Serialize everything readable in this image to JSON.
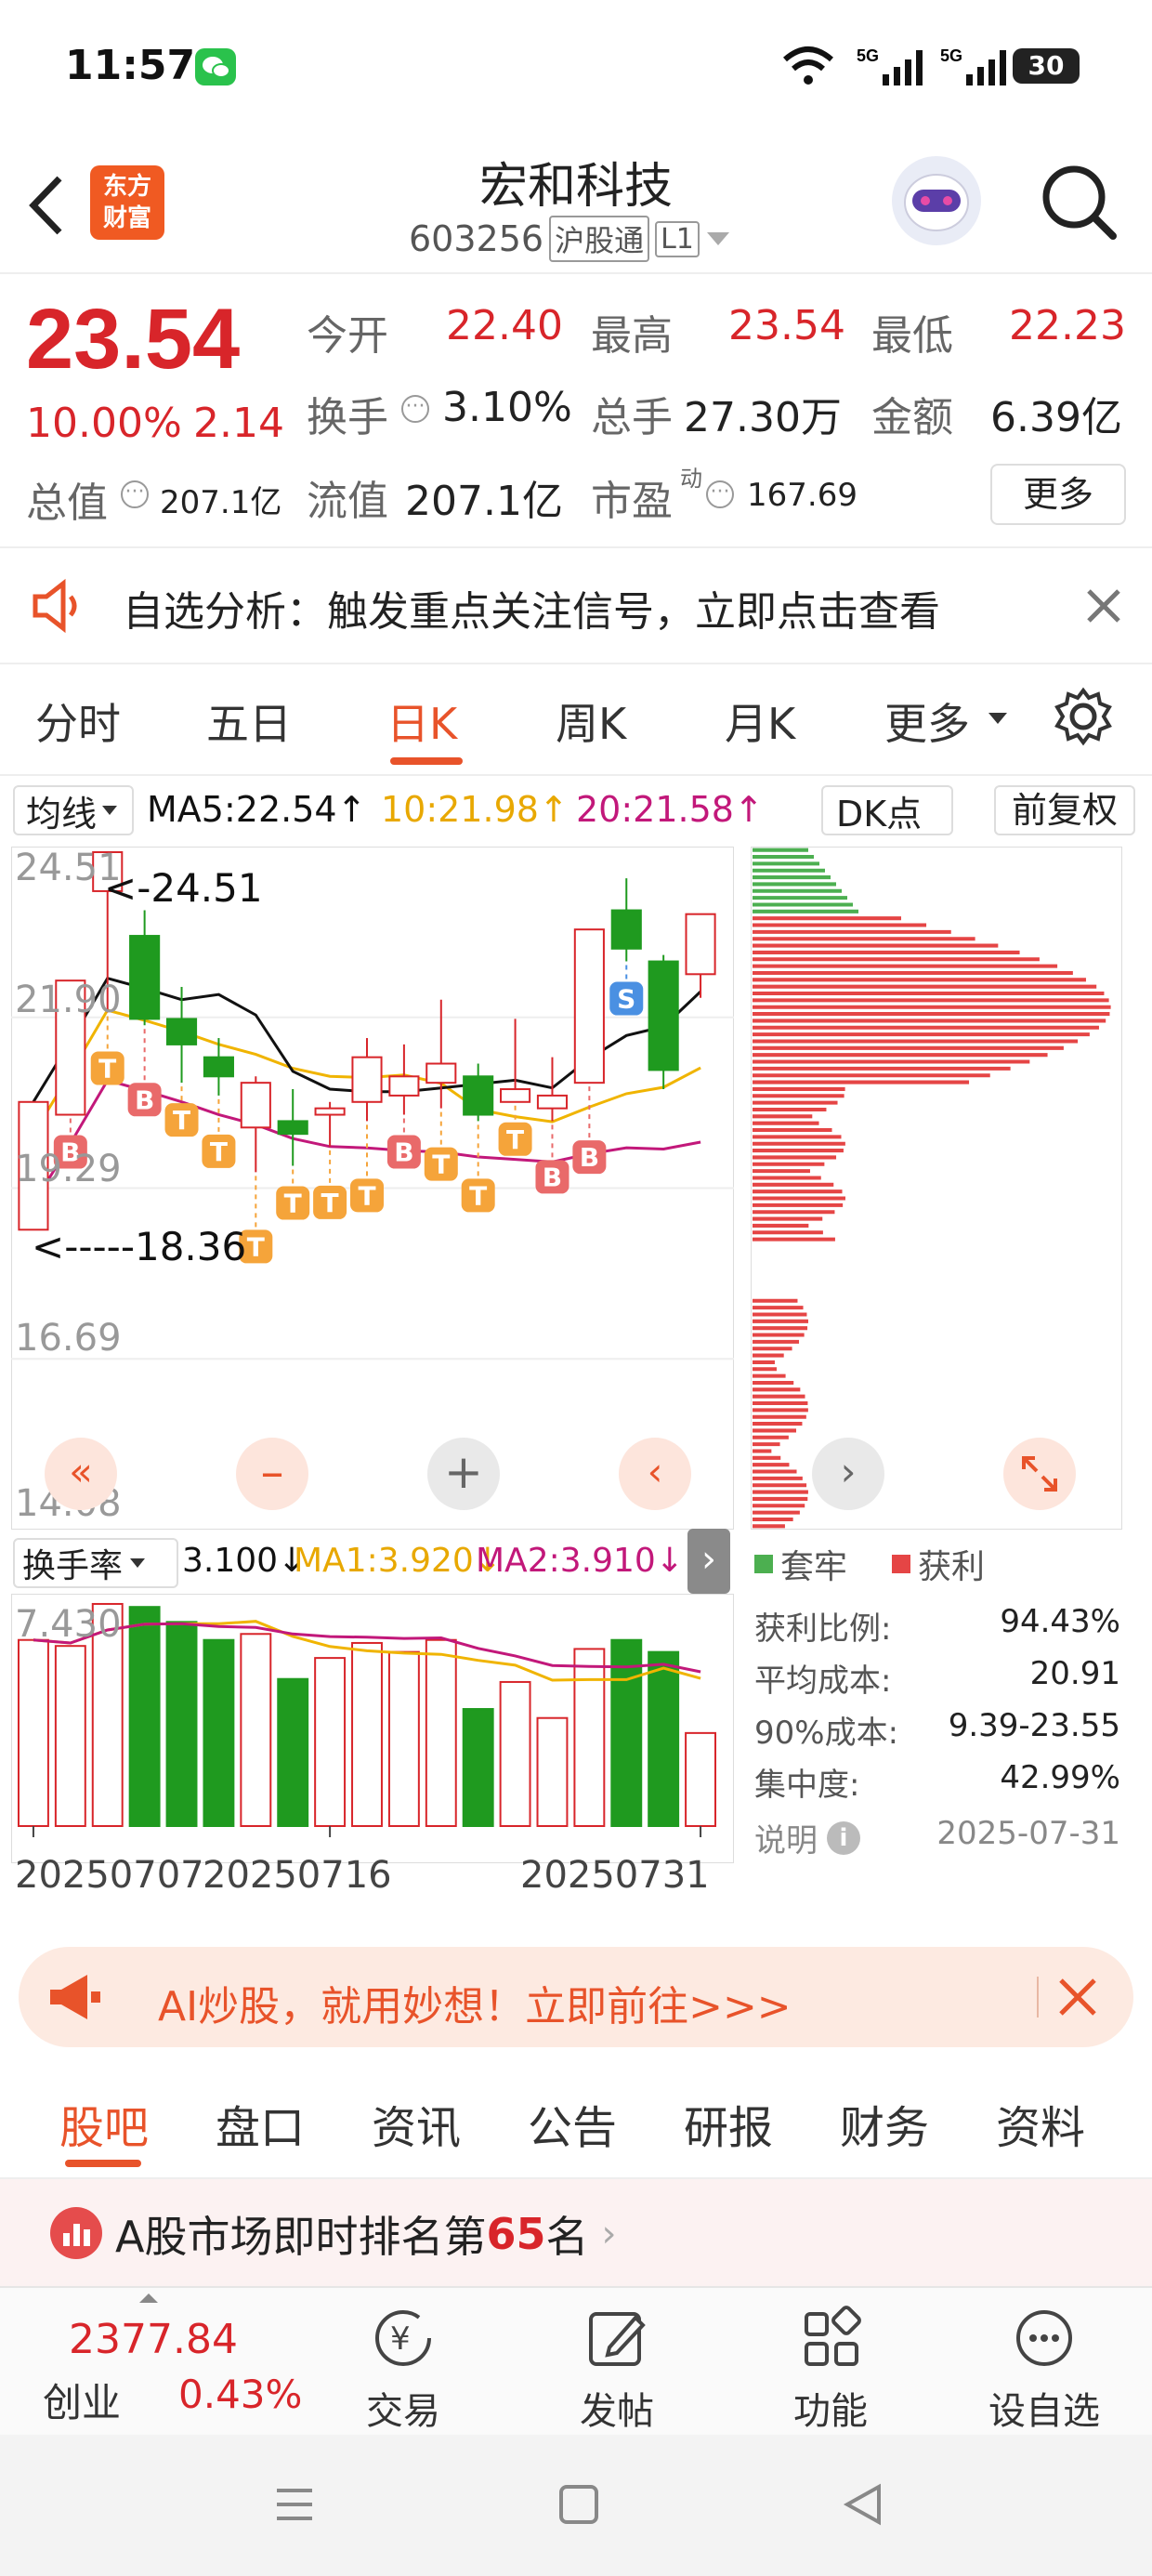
{
  "status_bar": {
    "time": "11:57",
    "signal1": "5G",
    "signal2": "5G",
    "battery": "30"
  },
  "header": {
    "logo_text": "东方\n财富",
    "title": "宏和科技",
    "code": "603256",
    "exchange_badge": "沪股通",
    "level_badge": "L1"
  },
  "quote": {
    "price": "23.54",
    "change_pct": "10.00%",
    "change_amt": "2.14",
    "open_label": "今开",
    "open": "22.40",
    "high_label": "最高",
    "high": "23.54",
    "low_label": "最低",
    "low": "22.23",
    "turnover_label": "换手",
    "turnover": "3.10%",
    "volume_label": "总手",
    "volume": "27.30万",
    "amount_label": "金额",
    "amount": "6.39亿",
    "mktcap_label": "总值",
    "mktcap": "207.1亿",
    "float_label": "流值",
    "float": "207.1亿",
    "pe_label": "市盈",
    "pe_sup": "动",
    "pe": "167.69",
    "more_btn": "更多"
  },
  "notice": {
    "text": "自选分析：触发重点关注信号，立即点击查看"
  },
  "chart_tabs": [
    "分时",
    "五日",
    "日K",
    "周K",
    "月K",
    "更多"
  ],
  "chart_tabs_active": "日K",
  "kline": {
    "indicator_select": "均线",
    "ma5": "MA5:22.54↑",
    "ma10": "10:21.98↑",
    "ma20": "20:21.58↑",
    "dk_btn": "DK点",
    "fq_btn": "前复权",
    "y_ticks": [
      "24.51",
      "21.90",
      "19.29",
      "16.69",
      "14.08"
    ],
    "high_mark": "<-24.51",
    "low_mark": "<-----18.36",
    "sub_select": "换手率",
    "sub_value": "3.100↓",
    "sub_ma1": "MA1:3.920↓",
    "sub_ma2": "MA2:3.910↓",
    "sub_y": "7.430",
    "x_labels": [
      "20250707",
      "20250716",
      "20250731"
    ]
  },
  "chart_data": {
    "type": "candlestick",
    "dates_shown": [
      "20250707",
      "20250716",
      "20250731"
    ],
    "ylim": [
      14.08,
      24.51
    ],
    "candles": [
      {
        "o": 18.6,
        "c": 20.6,
        "h": 20.6,
        "l": 18.6
      },
      {
        "o": 20.4,
        "c": 22.5,
        "h": 22.5,
        "l": 20.4
      },
      {
        "o": 23.9,
        "c": 24.51,
        "h": 24.51,
        "l": 22.0
      },
      {
        "o": 23.2,
        "c": 21.9,
        "h": 23.6,
        "l": 21.8
      },
      {
        "o": 21.9,
        "c": 21.5,
        "h": 22.4,
        "l": 20.9
      },
      {
        "o": 21.3,
        "c": 21.0,
        "h": 21.6,
        "l": 20.7
      },
      {
        "o": 20.2,
        "c": 20.9,
        "h": 21.0,
        "l": 19.5
      },
      {
        "o": 20.3,
        "c": 20.1,
        "h": 20.8,
        "l": 19.6
      },
      {
        "o": 20.4,
        "c": 20.5,
        "h": 20.6,
        "l": 19.9
      },
      {
        "o": 20.6,
        "c": 21.3,
        "h": 21.6,
        "l": 20.3
      },
      {
        "o": 20.7,
        "c": 21.0,
        "h": 21.5,
        "l": 20.4
      },
      {
        "o": 20.9,
        "c": 21.2,
        "h": 22.2,
        "l": 20.5
      },
      {
        "o": 21.0,
        "c": 20.4,
        "h": 21.2,
        "l": 20.3
      },
      {
        "o": 20.6,
        "c": 20.8,
        "h": 21.9,
        "l": 20.6
      },
      {
        "o": 20.5,
        "c": 20.7,
        "h": 21.3,
        "l": 20.3
      },
      {
        "o": 20.9,
        "c": 23.3,
        "h": 23.3,
        "l": 20.9
      },
      {
        "o": 23.6,
        "c": 23.0,
        "h": 24.1,
        "l": 22.8
      },
      {
        "o": 22.8,
        "c": 21.1,
        "h": 22.9,
        "l": 20.8
      },
      {
        "o": 22.6,
        "c": 23.54,
        "h": 23.54,
        "l": 22.23
      }
    ],
    "ma_colors": {
      "ma5": "#111111",
      "ma10": "#f0b400",
      "ma20": "#c2187a"
    },
    "signals": [
      "B",
      "T",
      "B",
      "T",
      "T",
      "T",
      "T",
      "T",
      "T",
      "B",
      "T",
      "T",
      "T",
      "B",
      "B",
      "S"
    ],
    "turnover_ylim": [
      0,
      7.43
    ],
    "turnover": [
      6.2,
      6.0,
      7.4,
      7.3,
      6.8,
      6.2,
      6.4,
      4.9,
      5.6,
      6.1,
      5.8,
      6.2,
      3.9,
      4.8,
      3.6,
      5.9,
      6.2,
      5.8,
      3.1
    ],
    "cost_distribution": {
      "legend_trap": "套牢",
      "legend_profit": "获利",
      "profit_ratio_label": "获利比例:",
      "profit_ratio": "94.43%",
      "avg_cost_label": "平均成本:",
      "avg_cost": "20.91",
      "cost90_label": "90%成本:",
      "cost90": "9.39-23.55",
      "concentration_label": "集中度:",
      "concentration": "42.99%",
      "note_label": "说明",
      "date": "2025-07-31"
    }
  },
  "ad": {
    "text": "AI炒股，就用妙想！立即前往>>>"
  },
  "bottom_tabs": [
    "股吧",
    "盘口",
    "资讯",
    "公告",
    "研报",
    "财务",
    "资料"
  ],
  "bottom_tabs_active": "股吧",
  "rank": {
    "prefix": "A股市场即时排名第",
    "number": "65",
    "suffix": "名"
  },
  "bottom_nav": {
    "index_value": "2377.84",
    "index_name": "创业",
    "index_change": "0.43%",
    "items": [
      "交易",
      "发帖",
      "功能",
      "设自选"
    ]
  },
  "colors": {
    "up": "#d8252a",
    "down": "#1f9a1f",
    "accent": "#e8532a"
  }
}
